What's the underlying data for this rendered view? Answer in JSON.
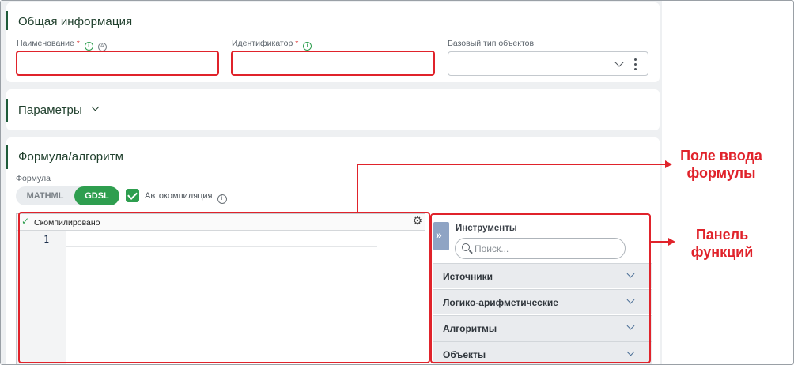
{
  "general": {
    "title": "Общая информация",
    "name_label": "Наименование",
    "id_label": "Идентификатор",
    "required_mark": "*",
    "info_icon": "i",
    "auto_icon": "A",
    "base_type_label": "Базовый тип объектов"
  },
  "parameters": {
    "title": "Параметры"
  },
  "formula_section": {
    "title": "Формула/алгоритм",
    "formula_label": "Формула",
    "modes": [
      "MATHML",
      "GDSL"
    ],
    "active_mode": "GDSL",
    "autocompile_label": "Автокомпиляция",
    "autocompile_checked": true,
    "editor": {
      "status": "Скомпилировано",
      "line_number": "1"
    },
    "tools": {
      "title": "Инструменты",
      "search_placeholder": "Поиск...",
      "categories": [
        "Источники",
        "Логико-арифметические",
        "Алгоритмы",
        "Объекты"
      ]
    }
  },
  "annotations": {
    "formula_input": "Поле ввода\nформулы",
    "functions_panel": "Панель\nфункций"
  },
  "colors": {
    "accent_green": "#2e9e4f",
    "annotation_red": "#e0232b",
    "section_bar": "#1f5b3a"
  }
}
